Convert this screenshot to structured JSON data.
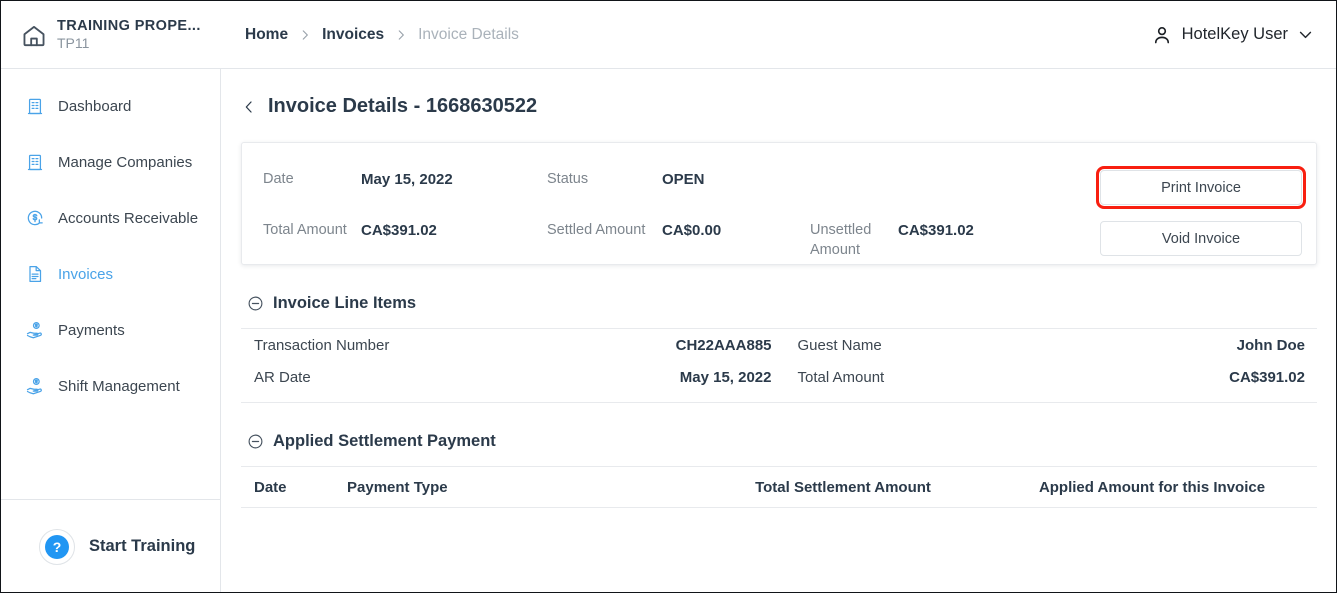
{
  "brand": {
    "icon": "home-icon",
    "name": "TRAINING PROPE...",
    "code": "TP11"
  },
  "breadcrumb": {
    "items": [
      {
        "label": "Home",
        "current": false
      },
      {
        "label": "Invoices",
        "current": false
      },
      {
        "label": "Invoice Details",
        "current": true
      }
    ],
    "separator": "›"
  },
  "user_menu": {
    "icon": "user-icon",
    "name": "HotelKey User",
    "chevron": "chevron-down-icon"
  },
  "sidebar": {
    "items": [
      {
        "label": "Dashboard",
        "icon": "building-icon",
        "active": false
      },
      {
        "label": "Manage Companies",
        "icon": "building-icon",
        "active": false
      },
      {
        "label": "Accounts Receivable",
        "icon": "dollar-refresh-icon",
        "active": false
      },
      {
        "label": "Invoices",
        "icon": "document-icon",
        "active": true
      },
      {
        "label": "Payments",
        "icon": "hand-coin-icon",
        "active": false
      },
      {
        "label": "Shift Management",
        "icon": "hand-coin-icon",
        "active": false
      }
    ],
    "training": {
      "badge": "?",
      "label": "Start Training"
    }
  },
  "page": {
    "back_icon": "chevron-left-icon",
    "title": "Invoice Details - 1668630522"
  },
  "summary": {
    "date_label": "Date",
    "date_value": "May 15, 2022",
    "status_label": "Status",
    "status_value": "OPEN",
    "total_label": "Total Amount",
    "total_value": "CA$391.02",
    "settled_label": "Settled Amount",
    "settled_value": "CA$0.00",
    "unsettled_label": "Unsettled Amount",
    "unsettled_value": "CA$391.02",
    "print_button": "Print Invoice",
    "void_button": "Void Invoice",
    "highlight_color": "#f81f10"
  },
  "line_items_section": {
    "collapse_icon": "circle-minus-icon",
    "title": "Invoice Line Items",
    "rows": [
      {
        "label1": "Transaction Number",
        "value1": "CH22AAA885",
        "label2": "Guest Name",
        "value2": "John Doe"
      },
      {
        "label1": "AR Date",
        "value1": "May 15, 2022",
        "label2": "Total Amount",
        "value2": "CA$391.02"
      }
    ]
  },
  "settlement_section": {
    "collapse_icon": "circle-minus-icon",
    "title": "Applied Settlement Payment",
    "columns": [
      "Date",
      "Payment Type",
      "Total Settlement Amount",
      "Applied Amount for this Invoice"
    ]
  },
  "theme": {
    "accent": "#4aa3e8",
    "text_dark": "#2b3a4a",
    "text_muted": "#7d858d"
  }
}
